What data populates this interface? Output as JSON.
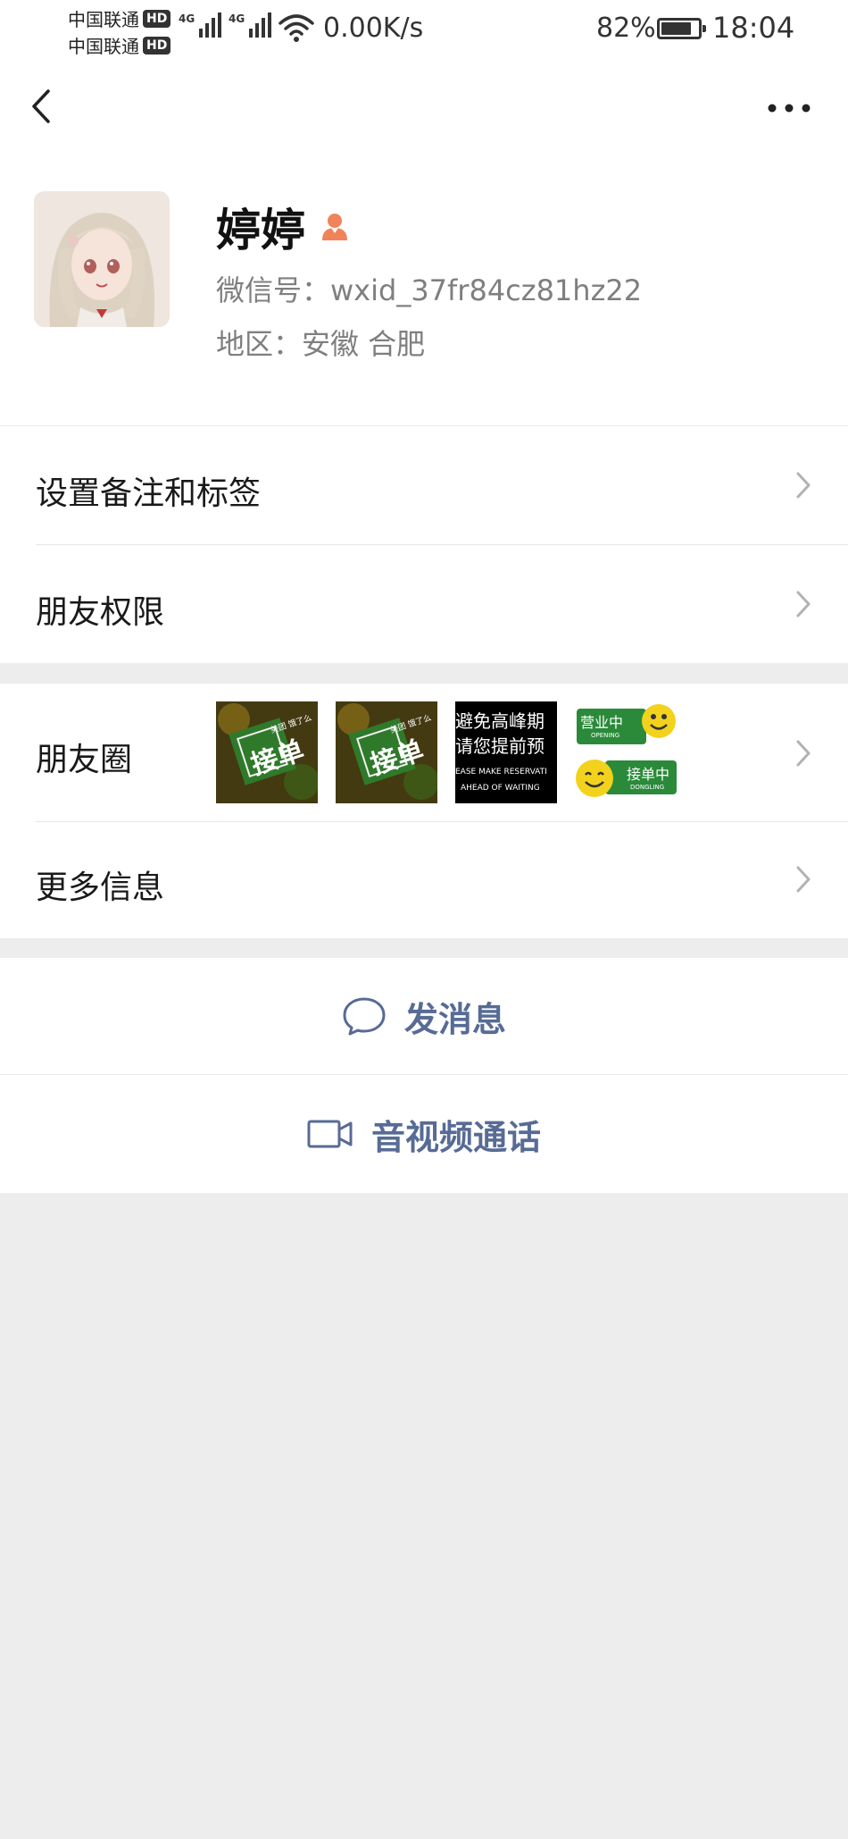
{
  "status_bar": {
    "carrier1": "中国联通",
    "carrier2": "中国联通",
    "hd": "HD",
    "network1": "4G",
    "network2": "4G",
    "speed": "0.00K/s",
    "battery_pct": "82%",
    "battery_level": 0.82,
    "time": "18:04"
  },
  "nav": {
    "back_icon": "chevron-left-icon",
    "more_icon": "ellipsis-icon"
  },
  "profile": {
    "name": "婷婷",
    "gender_icon": "female-icon",
    "wechat_id": "微信号：wxid_37fr84cz81hz22",
    "region": "地区：安徽  合肥"
  },
  "menu": {
    "remark_label": "设置备注和标签",
    "permissions_label": "朋友权限",
    "moments_label": "朋友圈",
    "more_info_label": "更多信息"
  },
  "moments": {
    "thumbs": [
      {
        "text": "接单",
        "sub": "美团 饿了么"
      },
      {
        "text": "接单",
        "sub": "美团 饿了么"
      },
      {
        "line1": "避免高峰期",
        "line2": "请您提前预",
        "line3": "EASE MAKE RESERVATI",
        "line4": "AHEAD OF WAITING"
      },
      {
        "top": "营业中",
        "top_sub": "OPENING",
        "bottom": "接单中",
        "bottom_sub": "DONGLING"
      }
    ]
  },
  "actions": {
    "message_label": "发消息",
    "call_label": "音视频通话"
  },
  "colors": {
    "link": "#576b95",
    "background": "#ededed"
  }
}
